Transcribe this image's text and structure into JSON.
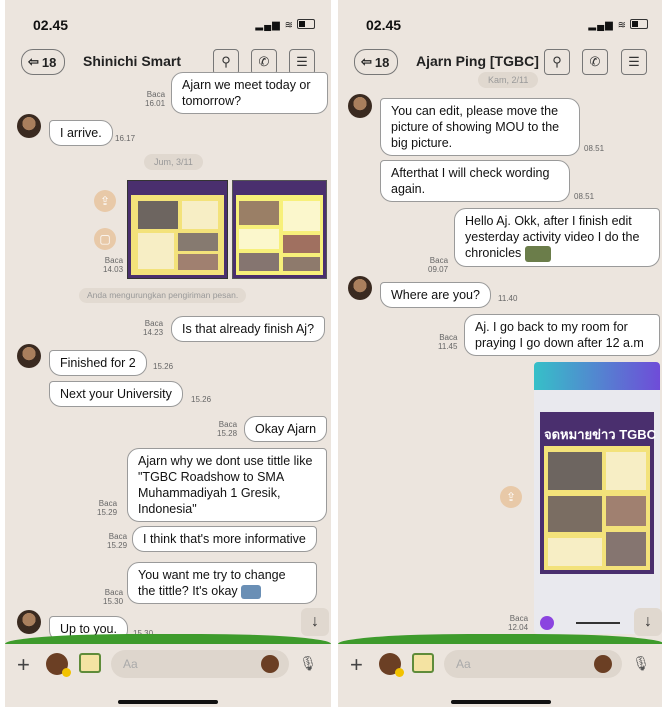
{
  "left": {
    "time": "02.45",
    "header": {
      "back_count": "18",
      "contact": "Shinichi Smart"
    },
    "messages": {
      "m1": {
        "text": "Ajarn we meet today or tomorrow?",
        "status": "Baca",
        "time": "16.01"
      },
      "m2": {
        "text": "I arrive.",
        "time": "16.17"
      },
      "date": "Jum, 3/11",
      "m3": {
        "status": "Baca",
        "time": "14.03"
      },
      "notice": "Anda mengurungkan pengiriman pesan.",
      "m4": {
        "text": "Is that already finish Aj?",
        "status": "Baca",
        "time": "14.23"
      },
      "m5": {
        "text": "Finished for 2",
        "time": "15.26"
      },
      "m6": {
        "text": "Next your University",
        "time": "15.26"
      },
      "m7": {
        "text": "Okay Ajarn",
        "status": "Baca",
        "time": "15.28"
      },
      "m8": {
        "text": "Ajarn why we dont use tittle like \"TGBC Roadshow to SMA Muhammadiyah 1 Gresik, Indonesia\"",
        "status": "Baca",
        "time": "15.29"
      },
      "m9": {
        "text": "I think that's more informative",
        "status": "Baca",
        "time": "15.29"
      },
      "m10": {
        "text": "You want me try to change the tittle? It's okay",
        "status": "Baca",
        "time": "15.30"
      },
      "m11": {
        "text": "Up to you.",
        "time": "15.30"
      }
    },
    "input_placeholder": "Aa"
  },
  "right": {
    "time": "02.45",
    "header": {
      "back_count": "18",
      "contact": "Ajarn Ping [TGBC]"
    },
    "messages": {
      "date": "Kam, 2/11",
      "m1": {
        "text": "You can edit, please move the picture of showing MOU to the big picture.",
        "time": "08.51"
      },
      "m2": {
        "text": "Afterthat I will check wording again.",
        "time": "08.51"
      },
      "m3": {
        "text": "Hello Aj. Okk, after I finish edit yesterday activity video I do the chronicles",
        "status": "Baca",
        "time": "09.07"
      },
      "m4": {
        "text": "Where are you?",
        "time": "11.40"
      },
      "m5": {
        "text": "Aj. I go back to my room for praying I go down after 12 a.m",
        "status": "Baca",
        "time": "11.45"
      },
      "m6": {
        "status": "Baca",
        "time": "12.04",
        "poster_title": "จดหมายข่าว TGBC"
      }
    },
    "input_placeholder": "Aa"
  },
  "icons": [
    "back-arrow-icon",
    "search-icon",
    "phone-icon",
    "menu-icon",
    "share-icon",
    "scroll-down-icon",
    "plus-icon",
    "sticker-icon",
    "image-icon",
    "emoji-icon",
    "mic-icon"
  ],
  "colors": {
    "chat_bg": "#ece5de",
    "bubble": "#ffffff",
    "accent_purple": "#8b44e0",
    "grass": "#3e9b2c"
  }
}
